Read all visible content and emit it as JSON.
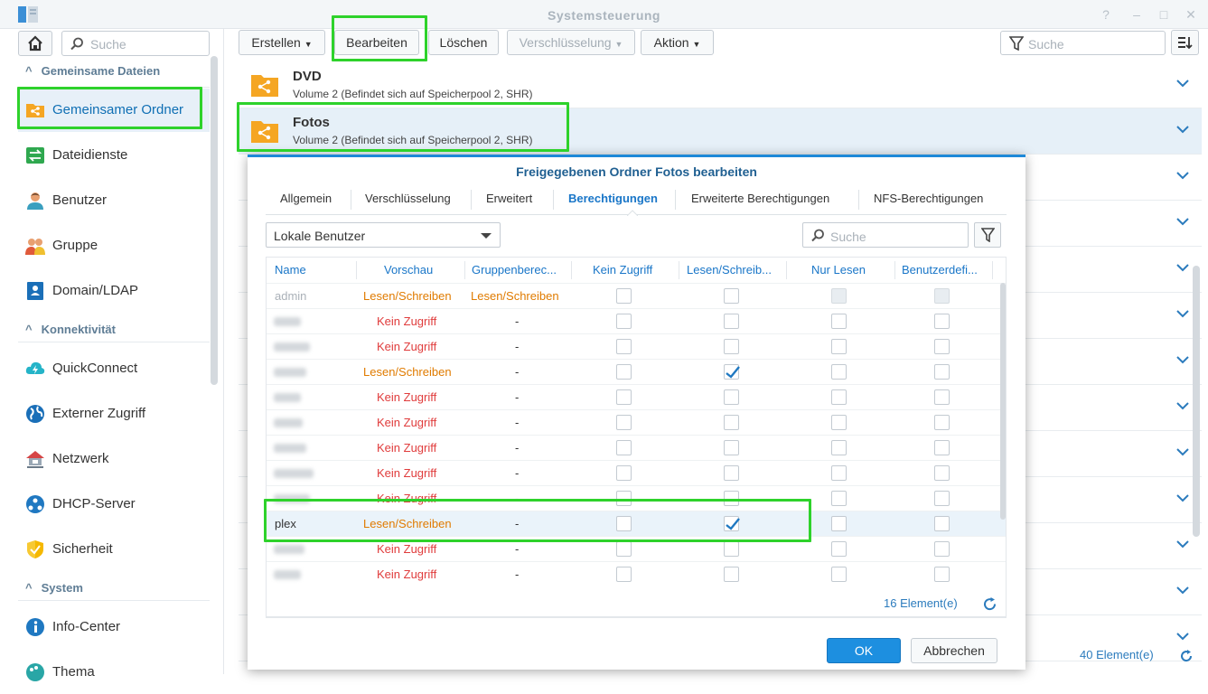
{
  "window": {
    "title": "Systemsteuerung",
    "controls": [
      "?",
      "–",
      "□",
      "✕"
    ]
  },
  "sidebar": {
    "search_placeholder": "Suche",
    "sections": [
      {
        "label": "Gemeinsame Dateien"
      },
      {
        "label": "Konnektivität"
      },
      {
        "label": "System"
      }
    ],
    "items": [
      {
        "label": "Gemeinsamer Ordner",
        "icon": "shared-folder-icon",
        "selected": true
      },
      {
        "label": "Dateidienste",
        "icon": "file-services-icon"
      },
      {
        "label": "Benutzer",
        "icon": "user-icon"
      },
      {
        "label": "Gruppe",
        "icon": "group-icon"
      },
      {
        "label": "Domain/LDAP",
        "icon": "domain-icon"
      },
      {
        "label": "QuickConnect",
        "icon": "quickconnect-icon"
      },
      {
        "label": "Externer Zugriff",
        "icon": "globe-icon"
      },
      {
        "label": "Netzwerk",
        "icon": "network-icon"
      },
      {
        "label": "DHCP-Server",
        "icon": "dhcp-icon"
      },
      {
        "label": "Sicherheit",
        "icon": "shield-icon"
      },
      {
        "label": "Info-Center",
        "icon": "info-icon"
      },
      {
        "label": "Thema",
        "icon": "palette-icon"
      }
    ]
  },
  "toolbar": {
    "create": "Erstellen",
    "edit": "Bearbeiten",
    "delete": "Löschen",
    "encryption": "Verschlüsselung",
    "action": "Aktion",
    "search_placeholder": "Suche"
  },
  "folders": [
    {
      "name": "DVD",
      "sub": "Volume 2 (Befindet sich auf Speicherpool 2, SHR)"
    },
    {
      "name": "Fotos",
      "sub": "Volume 2 (Befindet sich auf Speicherpool 2, SHR)",
      "selected": true
    }
  ],
  "total_count": "40 Element(e)",
  "dialog": {
    "title": "Freigegebenen Ordner Fotos bearbeiten",
    "tabs": [
      "Allgemein",
      "Verschlüsselung",
      "Erweitert",
      "Berechtigungen",
      "Erweiterte Berechtigungen",
      "NFS-Berechtigungen"
    ],
    "active_tab": "Berechtigungen",
    "user_type": "Lokale Benutzer",
    "search_placeholder": "Suche",
    "columns": [
      "Name",
      "Vorschau",
      "Gruppenberec...",
      "Kein Zugriff",
      "Lesen/Schreib...",
      "Nur Lesen",
      "Benutzerdefi..."
    ],
    "rows": [
      {
        "name": "admin",
        "preview": "Lesen/Schreiben",
        "group": "Lesen/Schreiben",
        "rw": false,
        "admin": true
      },
      {
        "name": "",
        "preview": "Kein Zugriff",
        "group": "-",
        "rw": false
      },
      {
        "name": "",
        "preview": "Kein Zugriff",
        "group": "-",
        "rw": false
      },
      {
        "name": "",
        "preview": "Lesen/Schreiben",
        "group": "-",
        "rw": true
      },
      {
        "name": "",
        "preview": "Kein Zugriff",
        "group": "-",
        "rw": false
      },
      {
        "name": "",
        "preview": "Kein Zugriff",
        "group": "-",
        "rw": false
      },
      {
        "name": "",
        "preview": "Kein Zugriff",
        "group": "-",
        "rw": false
      },
      {
        "name": "",
        "preview": "Kein Zugriff",
        "group": "-",
        "rw": false
      },
      {
        "name": "",
        "preview": "Kein Zugriff",
        "group": "-",
        "rw": false
      },
      {
        "name": "plex",
        "preview": "Lesen/Schreiben",
        "group": "-",
        "rw": true
      },
      {
        "name": "",
        "preview": "Kein Zugriff",
        "group": "-",
        "rw": false
      },
      {
        "name": "",
        "preview": "Kein Zugriff",
        "group": "-",
        "rw": false
      }
    ],
    "count": "16 Element(e)",
    "ok": "OK",
    "cancel": "Abbrechen"
  },
  "colors": {
    "accent": "#1976c8",
    "orange": "#e07b00",
    "red": "#e03c3c",
    "highlight": "#2ed22b"
  }
}
